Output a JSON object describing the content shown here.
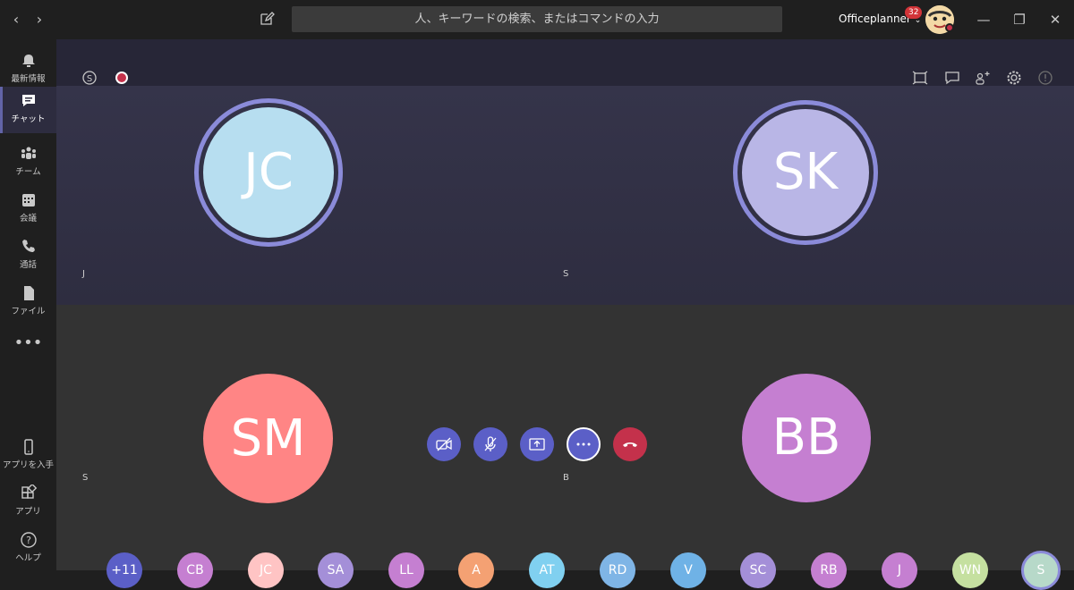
{
  "titlebar": {
    "search_placeholder": "人、キーワードの検索、またはコマンドの入力",
    "account_name": "Officeplanner",
    "notification_count": "32"
  },
  "rail": {
    "items": [
      {
        "label": "最新情報"
      },
      {
        "label": "チャット"
      },
      {
        "label": "チーム"
      },
      {
        "label": "会議"
      },
      {
        "label": "通話"
      },
      {
        "label": "ファイル"
      },
      {
        "label": "アプリを入手"
      },
      {
        "label": "アプリ"
      },
      {
        "label": "ヘルプ"
      }
    ]
  },
  "tiles": [
    {
      "initials": "JC",
      "name": "J",
      "color": "#b7def0"
    },
    {
      "initials": "SK",
      "name": "S",
      "color": "#b9b6e6"
    },
    {
      "initials": "SM",
      "name": "S",
      "color": "#ff8585"
    },
    {
      "initials": "BB",
      "name": "B",
      "color": "#c57fd1"
    }
  ],
  "roster": [
    {
      "initials": "+11",
      "color": "#5b5fc7"
    },
    {
      "initials": "CB",
      "color": "#c57fd1"
    },
    {
      "initials": "JC",
      "color": "#ffc4c4"
    },
    {
      "initials": "SA",
      "color": "#a48fd8"
    },
    {
      "initials": "LL",
      "color": "#c57fd1"
    },
    {
      "initials": "A",
      "color": "#f4a173"
    },
    {
      "initials": "AT",
      "color": "#80d0f0"
    },
    {
      "initials": "RD",
      "color": "#7fb5e6"
    },
    {
      "initials": "V",
      "color": "#6fb2e6"
    },
    {
      "initials": "SC",
      "color": "#a48fd8"
    },
    {
      "initials": "RB",
      "color": "#c57fd1"
    },
    {
      "initials": "J",
      "color": "#c57fd1"
    },
    {
      "initials": "WN",
      "color": "#c5e0a0"
    },
    {
      "initials": "S",
      "color": "#b7d9c9"
    }
  ]
}
